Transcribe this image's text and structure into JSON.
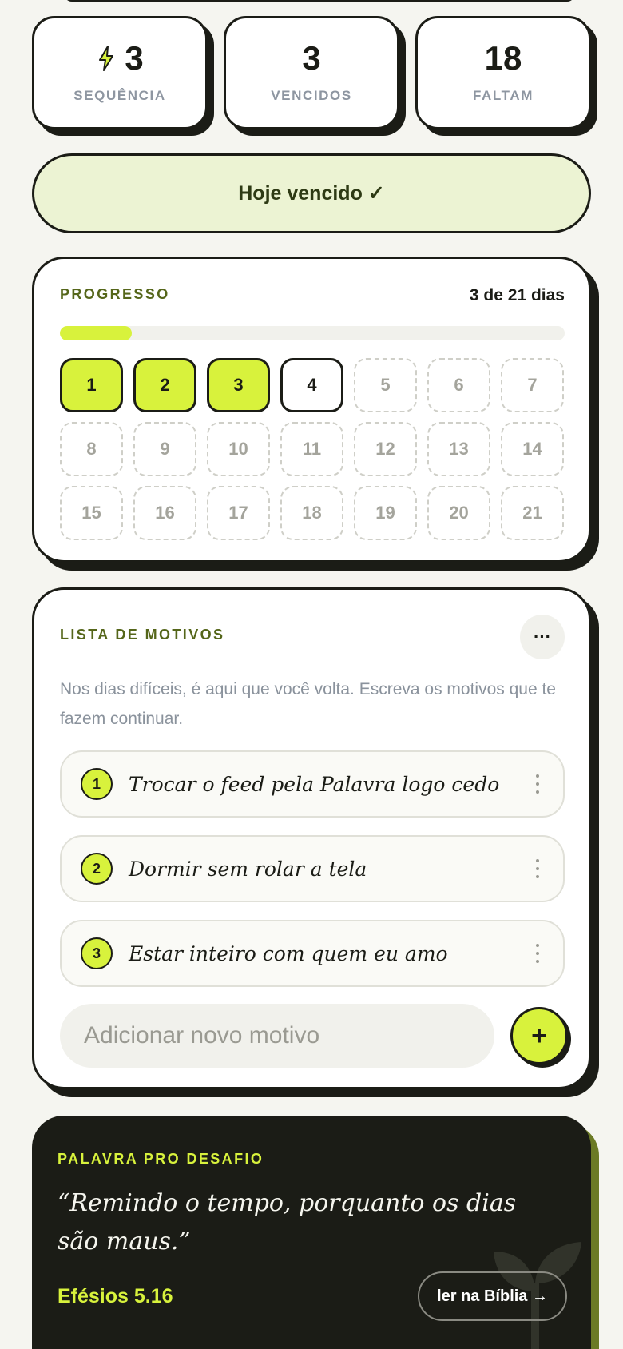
{
  "colors": {
    "accent": "#d8f23c",
    "ink": "#1b1c16",
    "olive": "#55661a",
    "muted": "#8e96a1"
  },
  "stats": [
    {
      "icon": "lightning-icon",
      "value": "3",
      "label": "SEQUÊNCIA"
    },
    {
      "value": "3",
      "label": "VENCIDOS"
    },
    {
      "value": "18",
      "label": "FALTAM"
    }
  ],
  "today_banner": "Hoje vencido ✓",
  "progress": {
    "label": "PROGRESSO",
    "count": "3 de 21 dias",
    "fraction": 0.143,
    "days": [
      {
        "n": "1",
        "state": "done"
      },
      {
        "n": "2",
        "state": "done"
      },
      {
        "n": "3",
        "state": "done"
      },
      {
        "n": "4",
        "state": "current"
      },
      {
        "n": "5",
        "state": "todo"
      },
      {
        "n": "6",
        "state": "todo"
      },
      {
        "n": "7",
        "state": "todo"
      },
      {
        "n": "8",
        "state": "todo"
      },
      {
        "n": "9",
        "state": "todo"
      },
      {
        "n": "10",
        "state": "todo"
      },
      {
        "n": "11",
        "state": "todo"
      },
      {
        "n": "12",
        "state": "todo"
      },
      {
        "n": "13",
        "state": "todo"
      },
      {
        "n": "14",
        "state": "todo"
      },
      {
        "n": "15",
        "state": "todo"
      },
      {
        "n": "16",
        "state": "todo"
      },
      {
        "n": "17",
        "state": "todo"
      },
      {
        "n": "18",
        "state": "todo"
      },
      {
        "n": "19",
        "state": "todo"
      },
      {
        "n": "20",
        "state": "todo"
      },
      {
        "n": "21",
        "state": "todo"
      }
    ]
  },
  "reasons": {
    "label": "LISTA DE MOTIVOS",
    "more_icon": "ellipsis-icon",
    "description": "Nos dias difíceis, é aqui que você volta. Escreva os motivos que te fazem continuar.",
    "items": [
      {
        "n": "1",
        "text": "Trocar o feed pela Palavra logo cedo"
      },
      {
        "n": "2",
        "text": "Dormir sem rolar a tela"
      },
      {
        "n": "3",
        "text": "Estar inteiro com quem eu amo"
      }
    ],
    "input_placeholder": "Adicionar novo motivo",
    "add_icon": "plus-icon"
  },
  "verse": {
    "label": "PALAVRA PRO DESAFIO",
    "text": "“Remindo o tempo, porquanto os dias são maus.”",
    "reference": "Efésios 5.16",
    "button": "ler na Bíblia →"
  }
}
